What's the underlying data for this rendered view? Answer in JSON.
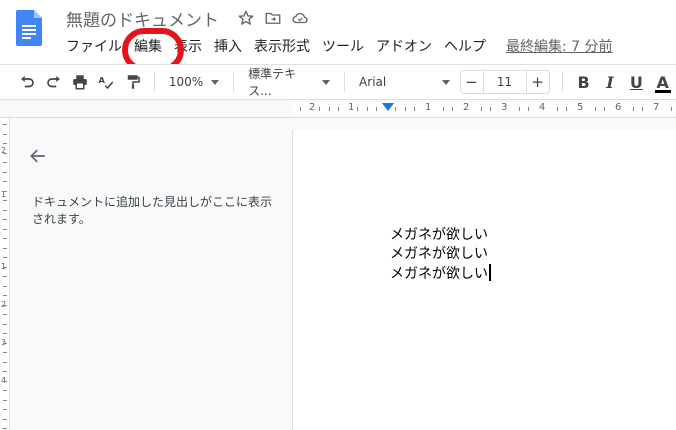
{
  "header": {
    "title": "無題のドキュメント",
    "title_icons": [
      "star-icon",
      "folder-move-icon",
      "cloud-icon"
    ]
  },
  "menu": {
    "items": [
      "ファイル",
      "編集",
      "表示",
      "挿入",
      "表示形式",
      "ツール",
      "アドオン",
      "ヘルプ"
    ],
    "last_edit": "最終編集: 7 分前",
    "highlighted_item": "編集"
  },
  "toolbar": {
    "zoom": "100%",
    "style": "標準テキス...",
    "font": "Arial",
    "font_size": "11",
    "minus": "−",
    "plus": "+",
    "bold": "B",
    "italic": "I",
    "underline": "U",
    "text_color": "A"
  },
  "ruler": {
    "numbers": [
      "2",
      "1",
      "1",
      "2",
      "3",
      "4",
      "5",
      "6",
      "7"
    ]
  },
  "vertical_ruler": {
    "numbers": [
      "2",
      "1",
      "1",
      "2",
      "3",
      "4"
    ]
  },
  "outline": {
    "placeholder": "ドキュメントに追加した見出しがここに表示されます。"
  },
  "document": {
    "lines": [
      "メガネが欲しい",
      "メガネが欲しい",
      "メガネが欲しい"
    ]
  },
  "colors": {
    "highlight_ring": "#e5141c",
    "docs_blue": "#4285f4",
    "ruler_marker": "#1a73e8"
  }
}
